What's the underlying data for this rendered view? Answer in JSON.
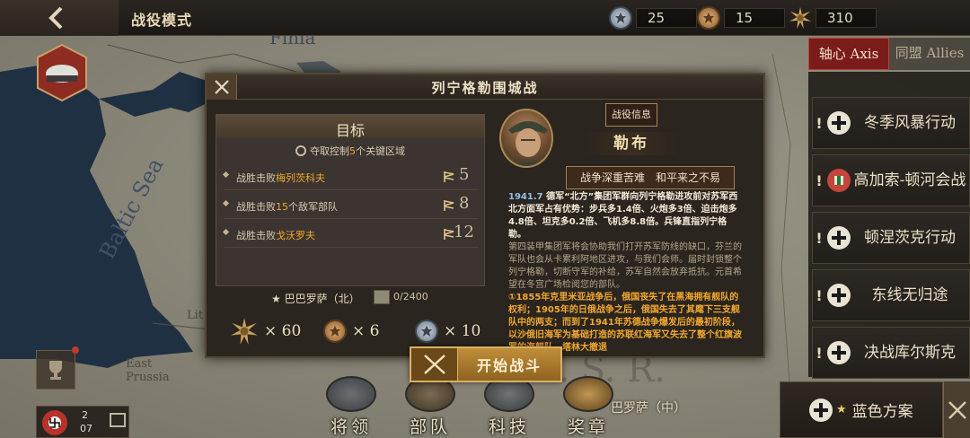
{
  "topbar": {
    "title": "战役模式",
    "currencies": [
      {
        "name": "silver-medal",
        "value": "25"
      },
      {
        "name": "bronze-medal",
        "value": "15"
      },
      {
        "name": "gold-star",
        "value": "310"
      }
    ]
  },
  "map": {
    "labels": {
      "sea": "Baltic Sea",
      "finland": "Finla",
      "lithuania": "Lit",
      "prussia": "East\nPrussia"
    }
  },
  "factions": {
    "axis": "轴心 Axis",
    "allies": "同盟 Allies"
  },
  "campaigns": [
    {
      "label": "冬季风暴行动",
      "icon": "iron-cross-icon"
    },
    {
      "label": "高加索-顿河会战",
      "icon": "medal-icon"
    },
    {
      "label": "顿涅茨克行动",
      "icon": "iron-cross-icon"
    },
    {
      "label": "东线无归途",
      "icon": "iron-cross-icon"
    },
    {
      "label": "决战库尔斯克",
      "icon": "iron-cross-icon"
    }
  ],
  "plan": {
    "label": "蓝色方案"
  },
  "turn": {
    "current": "2",
    "max": "07"
  },
  "bottom_menu": {
    "generals": "将领",
    "troops": "部队",
    "tech": "科技",
    "medals": "奖章",
    "map_label": "巴罗萨（中）"
  },
  "modal": {
    "title": "列宁格勒围城战",
    "objectives": {
      "title": "目标",
      "subtitle_pre": "夺取控制",
      "subtitle_num": "5",
      "subtitle_post": "个关键区域",
      "rows": [
        {
          "pre": "战胜击败",
          "hl": "梅列茨科夫",
          "post": "",
          "count": "5"
        },
        {
          "pre": "战胜击败",
          "hl": "15",
          "post": "个敌军部队",
          "count": "8"
        },
        {
          "pre": "战胜击败",
          "hl": "戈沃罗夫",
          "post": "",
          "count": "12"
        }
      ],
      "region": "★ 巴巴罗萨（北）",
      "supplies": "0/2400",
      "rewards": [
        {
          "icon": "gold-star-icon",
          "amount": "× 60"
        },
        {
          "icon": "bronze-medal-icon",
          "amount": "× 6"
        },
        {
          "icon": "silver-medal-icon",
          "amount": "× 10"
        }
      ]
    },
    "info_button": "战役信息",
    "general_name": "勒布",
    "motto": "战争深重苦难　和平来之不易",
    "story": {
      "year": "1941.7",
      "p1": " 德军“北方”集团军群向列宁格勒进攻前对苏军西北方面军占有优势：步兵多1.4倍、火炮多3倍、迫击炮多4.8倍、坦克多0.2倍、飞机多8.8倍。兵锋直指列宁格勒。",
      "p2": "第四装甲集团军将会协助我们打开苏军防线的缺口，芬兰的军队也会从卡累利阿地区进攻，与我们会师。届时封锁整个列宁格勒，切断守军的补给，苏军自然会放弃抵抗。元首希望在冬宫广场检阅您的部队。",
      "p3": "①1855年克里米亚战争后，俄国丧失了在黑海拥有舰队的权利；1905年的日俄战争之后，俄国失去了其麾下三支舰队中的两支；而到了1941年苏德战争爆发后的最初阶段，以沙俄旧海军为基础打造的苏联红海军又失去了整个红旗波罗的海舰队。塔林大撤退"
    },
    "start_button": "开始战斗"
  },
  "colors": {
    "accent_orange": "#f0a830",
    "axis_red": "#7a1c1a",
    "gold": "#bf8e3a"
  }
}
